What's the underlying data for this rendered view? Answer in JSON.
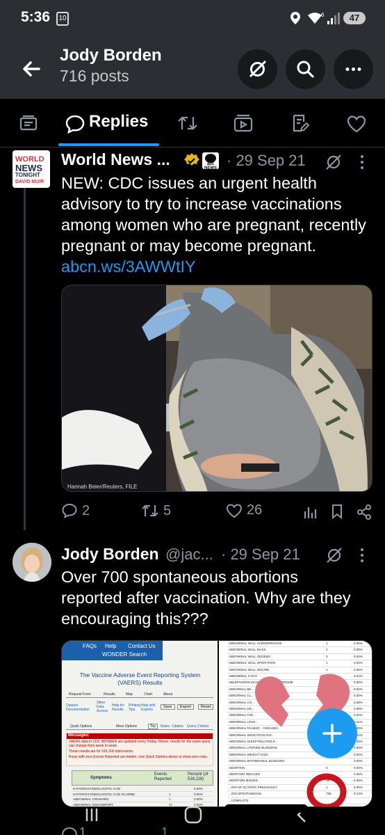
{
  "status_bar": {
    "time": "5:36",
    "calendar_day": "10",
    "battery": "47",
    "signal_label": "6"
  },
  "header": {
    "name": "Jody Borden",
    "post_count": "716 posts"
  },
  "tabs": {
    "active_label": "Replies"
  },
  "post1": {
    "avatar_lines": [
      "WORLD",
      "NEWS",
      "TONIGHT",
      "DAVID MUIR"
    ],
    "author": "World News ...",
    "badge_text": "abc NEWS",
    "date": "· 29 Sep 21",
    "text": "NEW: CDC issues an urgent health advisory to try to increase vaccinations among women who are pregnant, recently pregnant or may become pregnant.",
    "link": "abcn.ws/3AWWtIY",
    "image_credit": "Hannah Beier/Reuters, FILE",
    "replies": "2",
    "reposts": "5",
    "likes": "26"
  },
  "post2": {
    "author": "Jody Borden",
    "handle": "@jac...",
    "date": "· 29 Sep 21",
    "text": "Over 700 spontaneous abortions reported after vaccination. Why are they encouraging this???",
    "left_image": {
      "nav": [
        "FAQs",
        "Help",
        "Contact Us",
        "WONDER Search"
      ],
      "title": "The Vaccine Adverse Event Reporting System (VAERS) Results",
      "tabs": [
        "Request Form",
        "Results",
        "Map",
        "Chart",
        "About"
      ],
      "links": [
        "Dataset Documentation",
        "Other Data Access",
        "Help for Results",
        "Printing Tips",
        "Help with Exports"
      ],
      "buttons": [
        "Save",
        "Export",
        "Reset"
      ],
      "options_tab": "Quick Options",
      "more_options": "More Options",
      "top_links": [
        "Top",
        "Notes",
        "Citation",
        "Query Criteria"
      ],
      "messages_title": "Messages:",
      "messages": [
        "VAERS data in CDC WONDER are updated every Friday. Hence, results for the same query can change from week to week.",
        "These results are for 516,118 total events.",
        "Rows with zero Events Reported are hidden. Use Quick Options above to show zero rows."
      ],
      "columns": [
        "Symptoms",
        "Events Reported",
        "Percent (of 516,118)"
      ],
      "rows": [
        [
          "5-HYDROXYINDOLACETIC ACID",
          "",
          "0.00%"
        ],
        [
          "5-HYDROXYINDOLACETIC ACID IN URINE",
          "1",
          "0.00%"
        ],
        [
          "ABDOMINAL CRUSHING",
          "1",
          "0.00%"
        ],
        [
          "ABDOMINAL DISCOMFORT",
          "17",
          "0.00%"
        ]
      ]
    },
    "right_image": {
      "rows": [
        [
          "ABDOMINAL WALL HAEMORRHAGE",
          "1",
          "0.00%"
        ],
        [
          "ABDOMINAL WALL MASS",
          "1",
          "0.00%"
        ],
        [
          "ABDOMINAL WALL OEDEMA",
          "3",
          "0.00%"
        ],
        [
          "ABDOMINAL WALL OPERATION",
          "1",
          "0.00%"
        ],
        [
          "ABDOMINAL WALL WOUND",
          "1",
          "0.00%"
        ],
        [
          "ABDOMINAL X-RAY",
          "92",
          "0.02%"
        ],
        [
          "ABLEPHARON MACROSTOMIA SYNDROME",
          "",
          "0.00%"
        ],
        [
          "ABNORMAL BE...",
          "",
          "0.04%"
        ],
        [
          "ABNORMAL CL...",
          "",
          "0.00%"
        ],
        [
          "ABNORMAL CO...",
          "",
          "0.00%"
        ],
        [
          "ABNORMAL DR...",
          "",
          "0.08%"
        ],
        [
          "ABNORMAL FAE...",
          "",
          "0.02%"
        ],
        [
          "ABNORMAL LOSS...",
          "",
          "0.01%"
        ],
        [
          "ABNORMAL PALMAR... CREASES",
          "",
          "0.00%"
        ],
        [
          "ABNORMAL SENSATION IN E...",
          "",
          "0.02%"
        ],
        [
          "ABNORMAL SLEEP-RELATED E...",
          "",
          "0.00%"
        ],
        [
          "ABNORMAL UTERINE BLEEDING",
          "",
          "0.00%"
        ],
        [
          "ABNORMAL WEIGHT GAIN",
          "",
          "0.00%"
        ],
        [
          "ABNORMAL WITHDRAWAL BLEEDING",
          "",
          "0.00%"
        ],
        [
          "ABORTION",
          "6",
          "0.00%"
        ],
        [
          "ABORTION INDUCED",
          "",
          "0.00%"
        ],
        [
          "ABORTION MISSED",
          "18",
          "0.00%"
        ],
        [
          "...ION OF ECTOPIC PREGNANCY",
          "1",
          "0.00%"
        ],
        [
          "...ION SPONTANEOUS",
          "738",
          "0.14%"
        ],
        [
          "...COMPLETE",
          "",
          ""
        ]
      ]
    },
    "replies": "1",
    "reposts": "1"
  },
  "colors": {
    "accent": "#1d9bf0",
    "background": "#000000",
    "header_bg": "#2b2f33",
    "muted": "#8b98a5",
    "heart_emoji": "#e0737f"
  }
}
